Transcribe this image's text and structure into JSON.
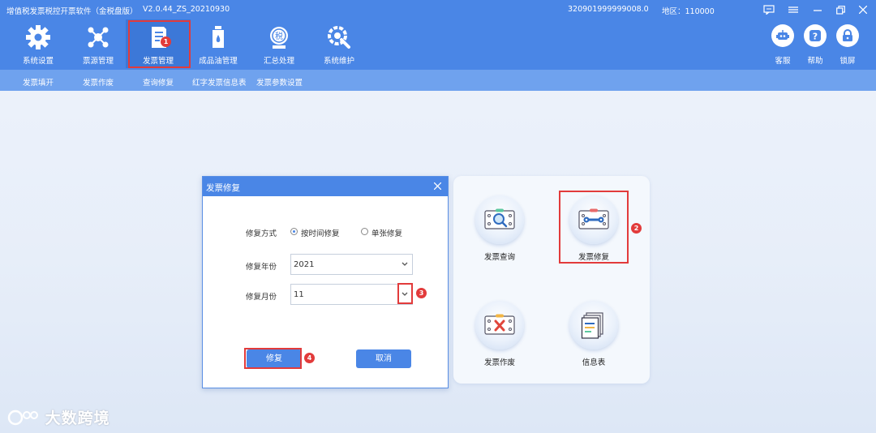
{
  "titlebar": {
    "app_title": "增值税发票税控开票软件（金税盘版）",
    "version": "V2.0.44_ZS_20210930",
    "machine_no": "320901999999008.0",
    "region": "地区：110000"
  },
  "toolbar": {
    "items": [
      {
        "label": "系统设置",
        "icon": "gear-icon"
      },
      {
        "label": "票源管理",
        "icon": "network-icon"
      },
      {
        "label": "发票管理",
        "icon": "invoice-icon"
      },
      {
        "label": "成品油管理",
        "icon": "oil-bottle-icon"
      },
      {
        "label": "汇总处理",
        "icon": "tax-stamp-icon"
      },
      {
        "label": "系统维护",
        "icon": "wrench-gear-icon"
      }
    ],
    "right": [
      {
        "label": "客服",
        "icon": "robot-icon"
      },
      {
        "label": "帮助",
        "icon": "help-icon"
      },
      {
        "label": "锁屏",
        "icon": "lock-icon"
      }
    ]
  },
  "submenu": [
    "发票填开",
    "发票作废",
    "查询修复",
    "红字发票信息表",
    "发票参数设置"
  ],
  "annotations": [
    "1",
    "2",
    "3",
    "4"
  ],
  "dialog": {
    "title": "发票修复",
    "mode_label": "修复方式",
    "mode_options": [
      "按时间修复",
      "单张修复"
    ],
    "mode_selected": "按时间修复",
    "year_label": "修复年份",
    "year_value": "2021",
    "month_label": "修复月份",
    "month_value": "11",
    "repair_button": "修复",
    "cancel_button": "取消"
  },
  "panel": {
    "items": [
      {
        "label": "发票查询",
        "icon": "invoice-search-icon"
      },
      {
        "label": "发票修复",
        "icon": "invoice-repair-icon"
      },
      {
        "label": "发票作废",
        "icon": "invoice-void-icon"
      },
      {
        "label": "信息表",
        "icon": "document-list-icon"
      }
    ]
  },
  "watermark": "大数跨境",
  "colors": {
    "primary": "#4a86e6",
    "submenu": "#6fa2ee",
    "annotation": "#e23b3b"
  }
}
